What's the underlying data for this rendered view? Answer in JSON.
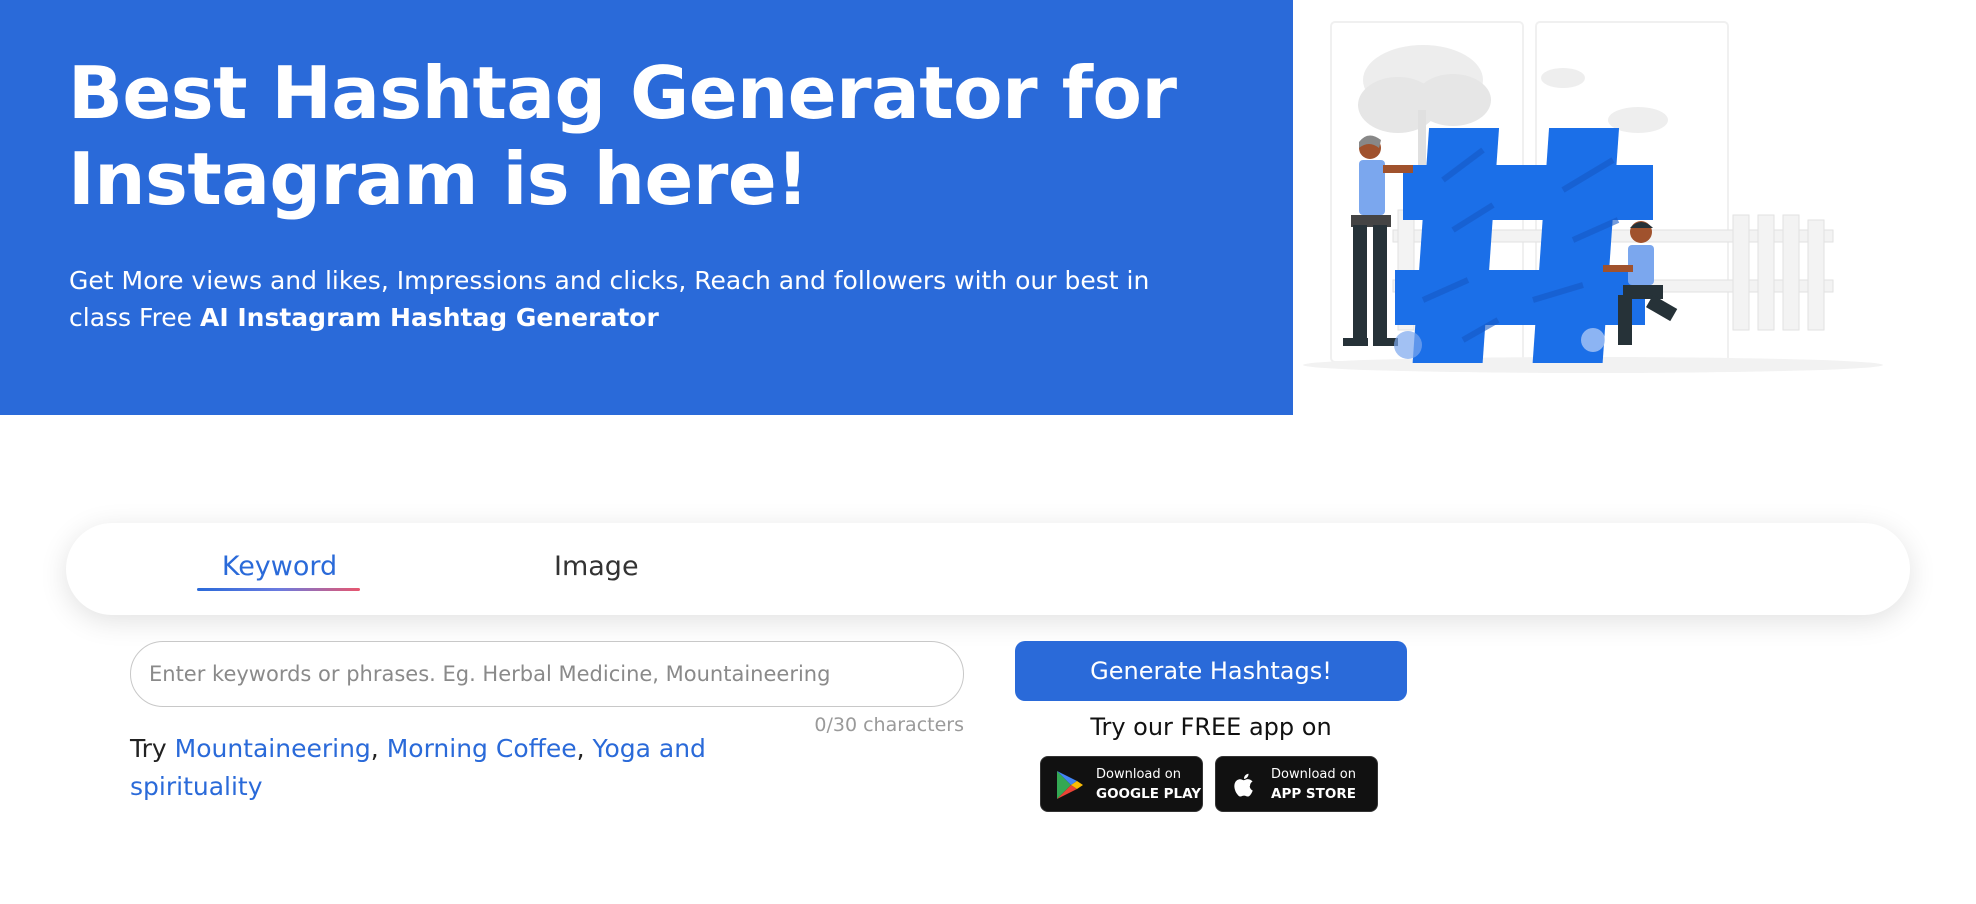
{
  "hero": {
    "title": "Best Hashtag Generator for Instagram is here!",
    "subtitle_lead": "Get More views and likes, Impressions and clicks, Reach and followers with our best in class Free ",
    "subtitle_bold": "AI Instagram Hashtag Generator"
  },
  "tabs": [
    {
      "label": "Keyword",
      "active": true
    },
    {
      "label": "Image",
      "active": false
    }
  ],
  "keyword_input": {
    "value": "",
    "placeholder": "Enter keywords or phrases. Eg. Herbal Medicine, Mountaineering",
    "char_count": "0/30 characters"
  },
  "suggestions": {
    "prefix": "Try",
    "items": [
      "Mountaineering",
      "Morning Coffee",
      "Yoga and spirituality"
    ],
    "separator": ","
  },
  "actions": {
    "generate_label": "Generate Hashtags!",
    "app_promo": "Try our FREE app on"
  },
  "store_badges": {
    "google_play": {
      "line1": "Download on",
      "line2": "GOOGLE PLAY",
      "icon": "google-play-icon"
    },
    "app_store": {
      "line1": "Download on",
      "line2": "APP STORE",
      "icon": "apple-icon"
    }
  },
  "colors": {
    "brand_blue": "#2a6ad9",
    "tab_underline_end": "#e8566e",
    "badge_bg": "#111111"
  }
}
